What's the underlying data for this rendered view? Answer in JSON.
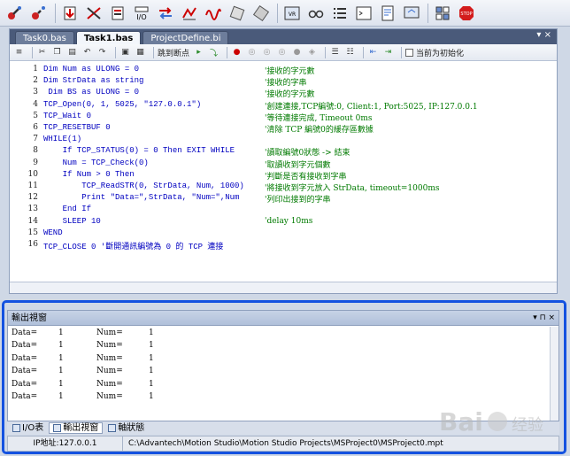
{
  "colors": {
    "accent": "#1452e0",
    "tabbar": "#4a5a7a",
    "code_text": "#0000c0",
    "code_comment": "#007a00"
  },
  "toolbar": {
    "icons": [
      "connect-icon",
      "disconnect-icon",
      "download-icon",
      "upload-icon",
      "project-icon",
      "io-icon",
      "transfer-icon",
      "scope-icon",
      "waveform-icon",
      "axis-icon",
      "axis-config-icon",
      "view-icon",
      "glasses-icon",
      "list-icon",
      "terminal-icon",
      "document-icon",
      "display-icon",
      "settings-icon",
      "stop-icon"
    ],
    "io_label": "I/O",
    "stop_label": "STOP"
  },
  "editor": {
    "tabs": [
      {
        "label": "Task0.bas",
        "active": false
      },
      {
        "label": "Task1.bas",
        "active": true
      },
      {
        "label": "ProjectDefine.bi",
        "active": false
      }
    ],
    "tab_controls": "▾ ×",
    "edit_toolbar": {
      "run_label": "跳到断点",
      "checkbox_label": "当前为初始化"
    },
    "lines": [
      {
        "no": "1",
        "code": "Dim Num as ULONG = 0",
        "comment": "'接收的字元數"
      },
      {
        "no": "2",
        "code": "Dim StrData as string",
        "comment": "'接收的字串"
      },
      {
        "no": "3",
        "code": " Dim BS as ULONG = 0",
        "comment": "'接收的字元數"
      },
      {
        "no": "4",
        "code": "TCP_Open(0, 1, 5025, \"127.0.0.1\")",
        "comment": "'創建連接,TCP編號:0, Client:1, Port:5025, IP:127.0.0.1"
      },
      {
        "no": "5",
        "code": "TCP_Wait 0",
        "comment": "'等待連接完成, Timeout 0ms"
      },
      {
        "no": "6",
        "code": "TCP_RESETBUF 0",
        "comment": "'清除 TCP 編號0的緩存區數據"
      },
      {
        "no": "7",
        "code": "WHILE(1)",
        "comment": ""
      },
      {
        "no": "8",
        "code": "    If TCP_STATUS(0) = 0 Then EXIT WHILE",
        "comment": "'讀取編號0狀態 -> 結束"
      },
      {
        "no": "9",
        "code": "    Num = TCP_Check(0)",
        "comment": "'取讀收到字元個數"
      },
      {
        "no": "10",
        "code": "    If Num > 0 Then",
        "comment": "'判斷是否有接收到字串"
      },
      {
        "no": "11",
        "code": "        TCP_ReadSTR(0, StrData, Num, 1000)",
        "comment": "'將接收到字元放入 StrData, timeout=1000ms"
      },
      {
        "no": "12",
        "code": "        Print \"Data=\",StrData, \"Num=\",Num",
        "comment": "'列印出接到的字串"
      },
      {
        "no": "13",
        "code": "    End If",
        "comment": ""
      },
      {
        "no": "14",
        "code": "    SLEEP 10",
        "comment": "'delay 10ms"
      },
      {
        "no": "15",
        "code": "WEND",
        "comment": ""
      },
      {
        "no": "16",
        "code": "TCP_CLOSE 0 '斷開通訊編號為 0 的 TCP 連接",
        "comment": ""
      }
    ]
  },
  "output": {
    "title": "輸出視窗",
    "controls": "▾ ⊓ ×",
    "rows": [
      {
        "label": "Data=",
        "value": "1",
        "num_label": "Num=",
        "num": "1"
      },
      {
        "label": "Data=",
        "value": "1",
        "num_label": "Num=",
        "num": "1"
      },
      {
        "label": "Data=",
        "value": "1",
        "num_label": "Num=",
        "num": "1"
      },
      {
        "label": "Data=",
        "value": "1",
        "num_label": "Num=",
        "num": "1"
      },
      {
        "label": "Data=",
        "value": "1",
        "num_label": "Num=",
        "num": "1"
      },
      {
        "label": "Data=",
        "value": "1",
        "num_label": "Num=",
        "num": "1"
      }
    ]
  },
  "bottom_tabs": [
    {
      "label": "I/O表",
      "active": false
    },
    {
      "label": "輸出視窗",
      "active": true
    },
    {
      "label": "軸狀態",
      "active": false
    }
  ],
  "statusbar": {
    "ip": "IP地址:127.0.0.1",
    "path": "C:\\Advantech\\Motion Studio\\Motion Studio Projects\\MSProject0\\MSProject0.mpt"
  },
  "watermark": "Baidu 经验"
}
